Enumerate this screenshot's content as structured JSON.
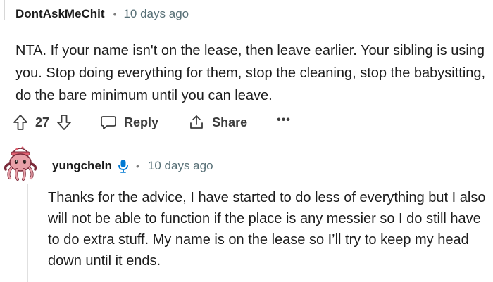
{
  "comment": {
    "author": "DontAskMeChit",
    "separator": "•",
    "time": "10 days ago",
    "body": "NTA. If your name isn't on the lease, then leave earlier. Your sibling is using you. Stop doing everything for them, stop the cleaning, stop the babysitting, do the bare minimum until you can leave.",
    "vote_count": "27",
    "reply_label": "Reply",
    "share_label": "Share",
    "more_label": "•••"
  },
  "reply": {
    "author": "yungcheln",
    "separator": "•",
    "time": "10 days ago",
    "body": "Thanks for the advice, I have started to do less of everything but I also will not be able to function if the place is any messier so I do still have to do extra stuff. My name is on the lease so I’ll try to keep my head down until it ends.",
    "author_badge_icon": "microphone-icon"
  },
  "colors": {
    "text": "#1c1c1c",
    "meta": "#576f76",
    "action": "#3c3c3c",
    "badge": "#0079d3",
    "avatar_body": "#e8a0a8",
    "avatar_dark": "#7a2a3a"
  }
}
